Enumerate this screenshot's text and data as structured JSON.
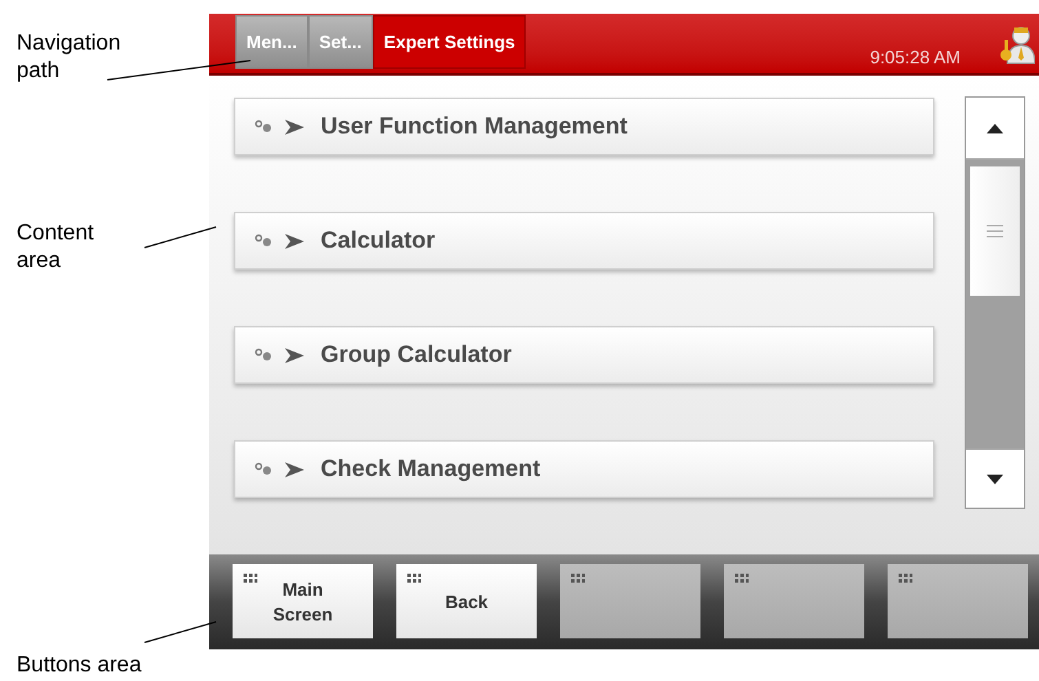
{
  "annotations": [
    {
      "text": "Navigation path"
    },
    {
      "text": "Content area"
    },
    {
      "text": "Buttons area"
    }
  ],
  "header": {
    "breadcrumbs": [
      {
        "label": "Men...",
        "selected": false
      },
      {
        "label": "Set...",
        "selected": false
      },
      {
        "label": "Expert Settings",
        "selected": true
      }
    ],
    "time": "9:05:28 AM"
  },
  "menu_items": [
    {
      "label": "User Function Management"
    },
    {
      "label": "Calculator"
    },
    {
      "label": "Group Calculator"
    },
    {
      "label": "Check Management"
    }
  ],
  "buttons": [
    {
      "label": "Main Screen",
      "disabled": false
    },
    {
      "label": "Back",
      "disabled": false
    },
    {
      "disabled": true
    },
    {
      "disabled": true
    },
    {
      "disabled": true
    }
  ]
}
